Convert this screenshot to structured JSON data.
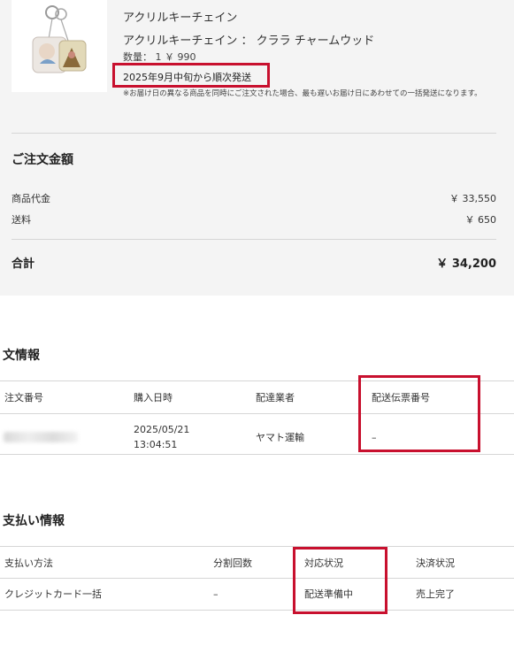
{
  "product": {
    "name": "アクリルキーチェイン",
    "variant": "アクリルキーチェイン ： クララ チャームウッド",
    "quantity": "数量： 1 ￥ 990",
    "ship_date": "2025年9月中旬から順次発送",
    "notice": "※お届け日の異なる商品を同時にご注文された場合、最も遅いお届け日にあわせての一括発送になります。"
  },
  "summary": {
    "title": "ご注文金額",
    "subtotal_label": "商品代金",
    "subtotal_value": "￥ 33,550",
    "shipping_label": "送料",
    "shipping_value": "￥ 650",
    "total_label": "合計",
    "total_value": "￥ 34,200"
  },
  "order_info": {
    "title": "文情報",
    "headers": [
      "注文番号",
      "購入日時",
      "配達業者",
      "配送伝票番号"
    ],
    "row": {
      "order_no": "",
      "date": "2025/05/21",
      "time": "13:04:51",
      "carrier": "ヤマト運輸",
      "tracking": "–"
    }
  },
  "payment_info": {
    "title": "支払い情報",
    "headers": [
      "支払い方法",
      "分割回数",
      "対応状況",
      "決済状況"
    ],
    "row": {
      "method": "クレジットカード一括",
      "installments": "–",
      "status": "配送準備中",
      "payment_status": "売上完了"
    }
  },
  "colors": {
    "highlight_box": "#c8102e",
    "panel_bg": "#f4f4f4"
  }
}
